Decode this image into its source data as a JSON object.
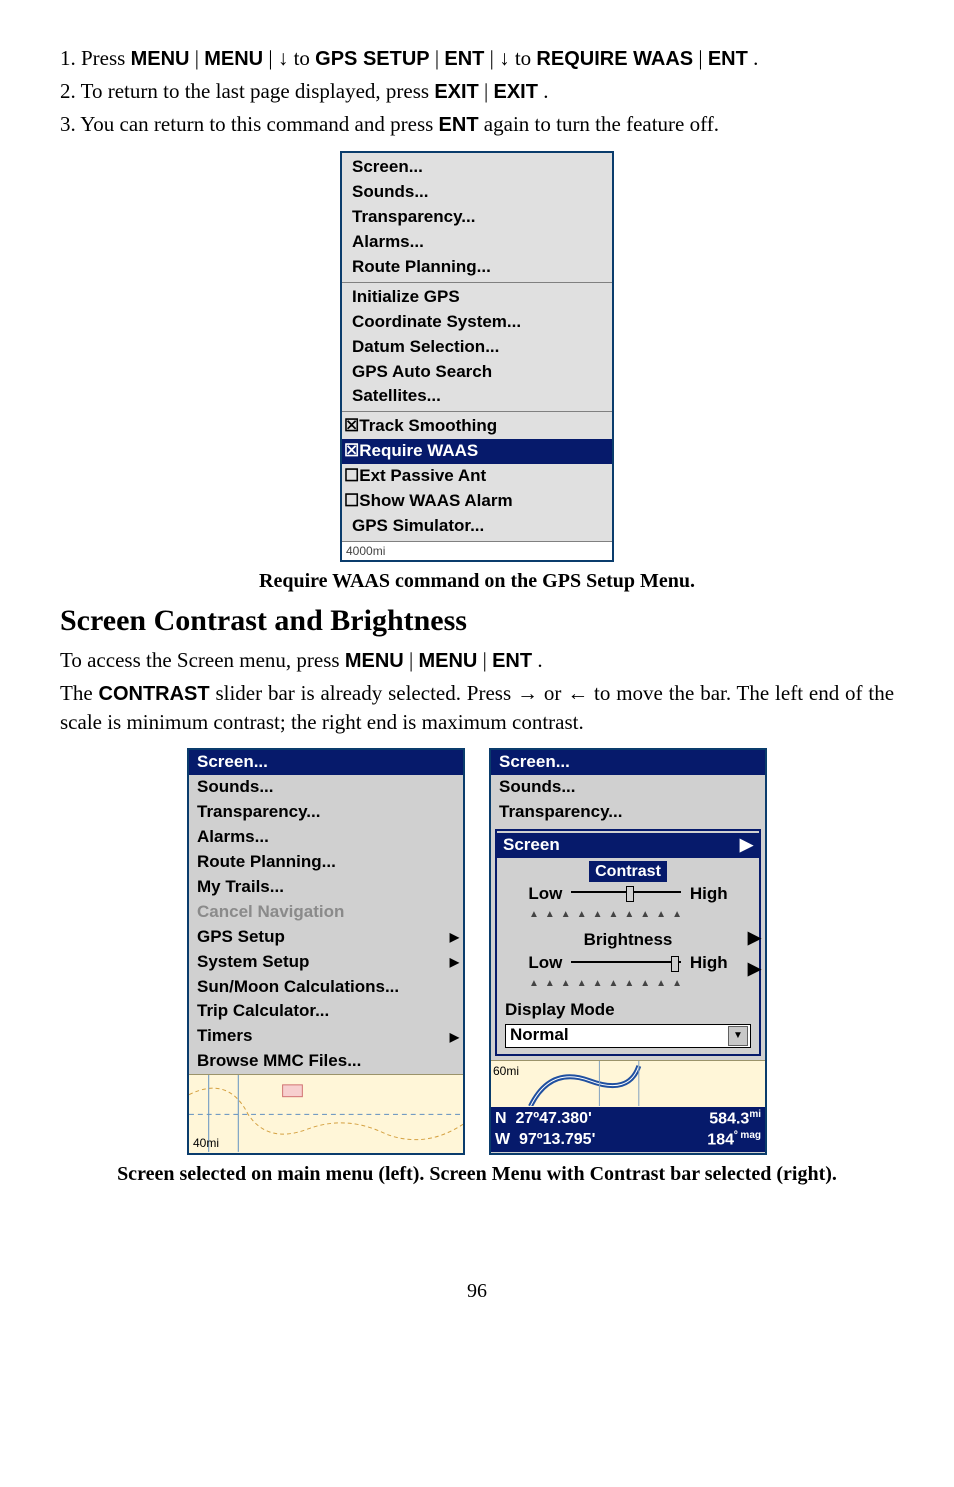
{
  "step1_parts": {
    "prefix": "1. Press ",
    "b1": "MENU",
    "sep1": "|",
    "b2": "MENU",
    "sep2": "|",
    "arr1": "↓",
    "to1": " to ",
    "b3": "GPS S",
    "b3s": "ETUP",
    "sep3": "|",
    "b4": "ENT",
    "sep4": "|",
    "arr2": "↓",
    "to2": " to ",
    "b5": "R",
    "b5s": "EQUIRE",
    "b6": " WAAS",
    "sep5": "|",
    "b7": "ENT",
    "end": "."
  },
  "step2_parts": {
    "prefix": "2. To return to the last page displayed, press ",
    "b1": "EXIT",
    "sep": "|",
    "b2": "EXIT",
    "end": "."
  },
  "step3_parts": {
    "prefix": "3. You can return to this command and press ",
    "b1": "ENT",
    "suffix": " again to turn the feature off."
  },
  "gps_menu": {
    "section1": [
      "Screen...",
      "Sounds...",
      "Transparency...",
      "Alarms...",
      "Route Planning..."
    ],
    "section2": [
      "Initialize GPS",
      "Coordinate System...",
      "Datum Selection...",
      "GPS Auto Search",
      "Satellites..."
    ],
    "section3": [
      {
        "checkbox": "☒",
        "label": "Track Smoothing",
        "hl": false
      },
      {
        "checkbox": "☒",
        "label": "Require WAAS",
        "hl": true
      },
      {
        "checkbox": "☐",
        "label": "Ext Passive Ant",
        "hl": false
      },
      {
        "checkbox": "☐",
        "label": "Show WAAS Alarm",
        "hl": false
      },
      {
        "checkbox": "",
        "label": "GPS Simulator...",
        "hl": false,
        "indent": true
      }
    ],
    "status": "4000mi"
  },
  "caption1": "Require WAAS command on the GPS Setup Menu.",
  "heading2": "Screen Contrast and Brightness",
  "para2_parts": {
    "prefix": "To access the Screen menu, press ",
    "b1": "MENU",
    "sep1": "|",
    "b2": "MENU",
    "sep2": "|",
    "b3": "ENT",
    "end": "."
  },
  "para3_parts": {
    "p1": "The ",
    "b1": "C",
    "b1s": "ONTRAST",
    "p2": " slider bar is already selected. Press ",
    "arr_r": "→",
    "or": " or ",
    "arr_l": "←",
    "p3": " to move the bar. The left end of the scale is minimum contrast; the right end is maximum contrast."
  },
  "left_panel": {
    "items": [
      {
        "label": "Screen...",
        "hl": true
      },
      {
        "label": "Sounds..."
      },
      {
        "label": "Transparency..."
      },
      {
        "label": "Alarms..."
      },
      {
        "label": "Route Planning..."
      },
      {
        "label": "My Trails..."
      },
      {
        "label": "Cancel Navigation",
        "disabled": true
      },
      {
        "label": "GPS Setup",
        "submenu": true
      },
      {
        "label": "System Setup",
        "submenu": true
      },
      {
        "label": "Sun/Moon Calculations..."
      },
      {
        "label": "Trip Calculator..."
      },
      {
        "label": "Timers",
        "submenu": true
      },
      {
        "label": "Browse MMC Files..."
      }
    ],
    "scale": "40mi"
  },
  "right_panel": {
    "top": [
      "Screen...",
      "Sounds...",
      "Transparency..."
    ],
    "overlay_title": "Screen",
    "contrast_label": "Contrast",
    "brightness_label": "Brightness",
    "low": "Low",
    "high": "High",
    "display_mode": "Display Mode",
    "display_value": "Normal",
    "scale": "60mi",
    "coords": {
      "n_label": "N",
      "n_val": "27º47.380'",
      "w_label": "W",
      "w_val": "97º13.795'",
      "dist": "584.3",
      "dist_unit": "mi",
      "brg": "184",
      "brg_unit": "º mag"
    }
  },
  "caption2": "Screen selected on main menu  (left). Screen Menu with Contrast bar selected (right).",
  "page_number": "96"
}
